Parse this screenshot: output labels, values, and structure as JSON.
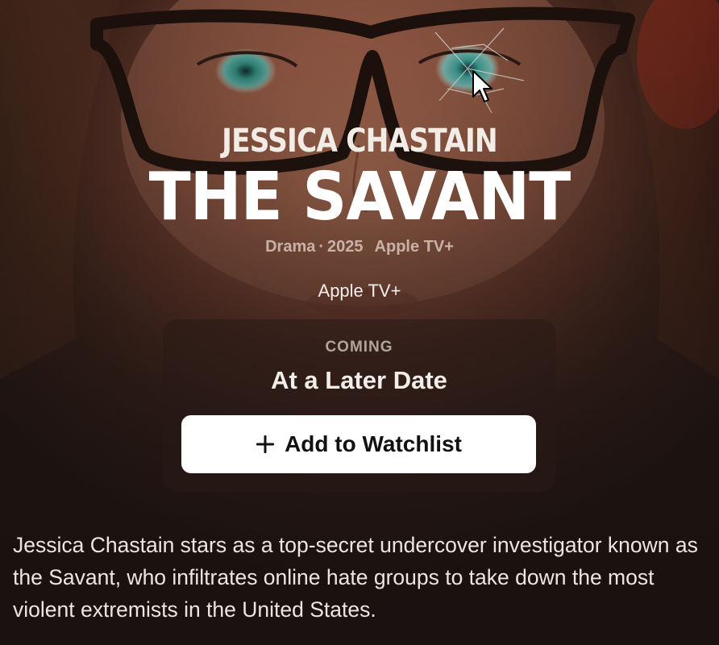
{
  "hero": {
    "actor": "JESSICA CHASTAIN",
    "title": "THE SAVANT",
    "meta": {
      "genre": "Drama",
      "separator": "·",
      "year": "2025",
      "service": "Apple TV+"
    },
    "channel": "Apple TV+"
  },
  "availability": {
    "status_label": "COMING",
    "date_label": "At a Later Date",
    "watchlist_button": "Add to Watchlist"
  },
  "synopsis": "Jessica Chastain stars as a top-secret undercover investigator known as the Savant, who infiltrates online hate groups to take down the most violent extremists in the United States.",
  "icons": {
    "watchlist": "plus-icon",
    "pointer": "mouse-cursor-icon"
  },
  "colors": {
    "button_bg": "#ffffff",
    "button_text": "#111111",
    "backdrop_dark": "#1a1210",
    "glasses_red": "#b02a1c"
  }
}
